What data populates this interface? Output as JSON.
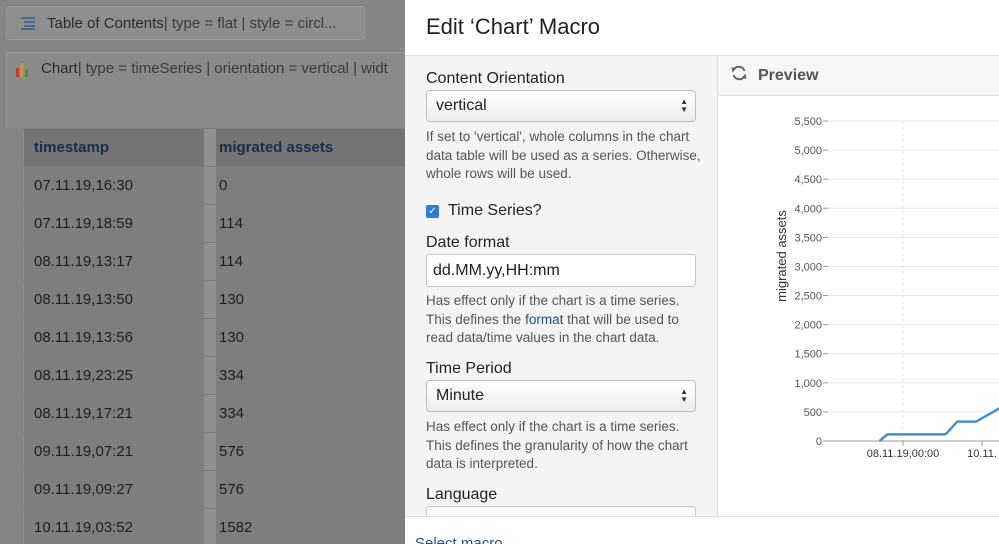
{
  "background": {
    "toc_macro": {
      "icon": "list-icon",
      "name": "Table of Contents",
      "params": " | type = flat | style = circl..."
    },
    "chart_macro": {
      "icon": "bar-chart-icon",
      "name": "Chart",
      "params": " | type = timeSeries | orientation = vertical | widt"
    },
    "table": {
      "headers": [
        "timestamp",
        "migrated assets"
      ],
      "rows": [
        [
          "07.11.19,16:30",
          "0"
        ],
        [
          "07.11.19,18:59",
          "114"
        ],
        [
          "08.11.19,13:17",
          "114"
        ],
        [
          "08.11.19,13:50",
          "130"
        ],
        [
          "08.11.19,13:56",
          "130"
        ],
        [
          "08.11.19,23:25",
          "334"
        ],
        [
          "08.11.19,17:21",
          "334"
        ],
        [
          "09.11.19,07:21",
          "576"
        ],
        [
          "09.11.19,09:27",
          "576"
        ],
        [
          "10.11.19,03:52",
          "1582"
        ]
      ]
    }
  },
  "dialog": {
    "title": "Edit ‘Chart’ Macro",
    "content_orientation": {
      "label": "Content Orientation",
      "value": "vertical",
      "help": "If set to 'vertical', whole columns in the chart data table will be used as a series. Otherwise, whole rows will be used."
    },
    "time_series": {
      "label": "Time Series?",
      "checked": true
    },
    "date_format": {
      "label": "Date format",
      "value": "dd.MM.yy,HH:mm",
      "help_before": "Has effect only if the chart is a time series. This defines the ",
      "help_link": "format",
      "help_after": " that will be used to read data/time values in the chart data."
    },
    "time_period": {
      "label": "Time Period",
      "value": "Minute",
      "help": "Has effect only if the chart is a time series. This defines the granularity of how the chart data is interpreted."
    },
    "language": {
      "label": "Language"
    },
    "preview": {
      "label": "Preview",
      "icon": "refresh-icon"
    },
    "footer": {
      "select_macro": "Select macro"
    }
  },
  "chart_data": {
    "type": "line",
    "ylabel": "migrated assets",
    "ylim": [
      0,
      5500
    ],
    "yticks": [
      0,
      500,
      1000,
      1500,
      2000,
      2500,
      3000,
      3500,
      4000,
      4500,
      5000,
      5500
    ],
    "ytick_labels": [
      "0",
      "500",
      "1,000",
      "1,500",
      "2,000",
      "2,500",
      "3,000",
      "3,500",
      "4,000",
      "4,500",
      "5,000",
      "5,500"
    ],
    "xtick_labels": [
      "08.11.19,00:00",
      "10.11."
    ],
    "series": [
      {
        "color": "#4a90c8",
        "x": [
          "07.11.19,16:30",
          "07.11.19,18:59",
          "08.11.19,13:17",
          "08.11.19,13:50",
          "08.11.19,13:56",
          "08.11.19,17:21",
          "08.11.19,23:25",
          "09.11.19,07:21",
          "09.11.19,09:27",
          "10.11.19,03:52"
        ],
        "values": [
          0,
          114,
          114,
          130,
          130,
          334,
          334,
          576,
          576,
          1582
        ]
      }
    ],
    "grid": true
  }
}
